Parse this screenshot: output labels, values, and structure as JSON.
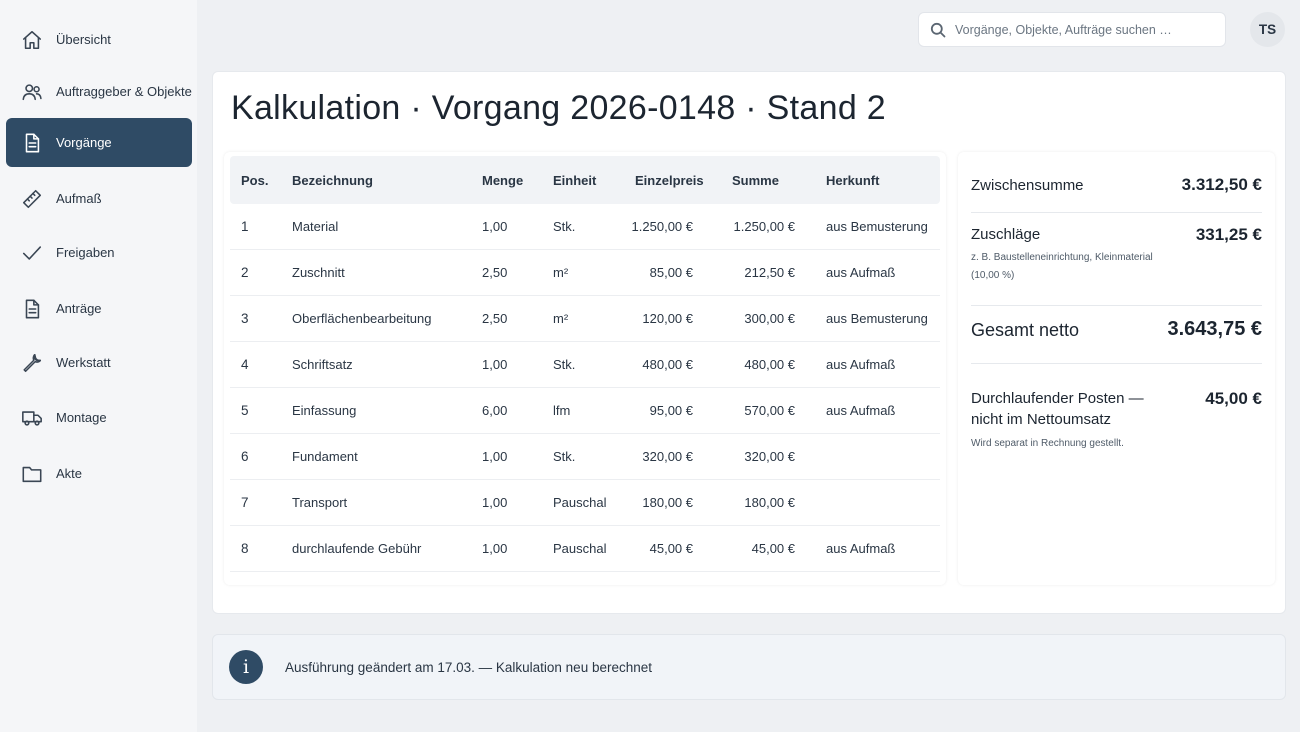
{
  "sidebar": {
    "items": [
      {
        "label": "Übersicht",
        "icon": "home-icon",
        "active": false
      },
      {
        "label": "Auftraggeber & Objekte",
        "icon": "users-icon",
        "active": false
      },
      {
        "label": "Vorgänge",
        "icon": "document-icon",
        "active": true
      },
      {
        "label": "Aufmaß",
        "icon": "ruler-icon",
        "active": false
      },
      {
        "label": "Freigaben",
        "icon": "checkmark-icon",
        "active": false
      },
      {
        "label": "Anträge",
        "icon": "document-icon",
        "active": false
      },
      {
        "label": "Werkstatt",
        "icon": "wrench-icon",
        "active": false
      },
      {
        "label": "Montage",
        "icon": "truck-icon",
        "active": false
      },
      {
        "label": "Akte",
        "icon": "folder-icon",
        "active": false
      }
    ]
  },
  "topbar": {
    "search_placeholder": "Vorgänge, Objekte, Aufträge suchen …",
    "avatar_initials": "TS"
  },
  "page": {
    "title": "Kalkulation · Vorgang 2026-0148 · Stand 2"
  },
  "table": {
    "headers": {
      "pos": "Pos.",
      "bezeichnung": "Bezeichnung",
      "menge": "Menge",
      "einheit": "Einheit",
      "einzelpreis": "Einzelpreis",
      "summe": "Summe",
      "herkunft": "Herkunft"
    },
    "rows": [
      {
        "pos": "1",
        "bezeichnung": "Material",
        "menge": "1,00",
        "einheit": "Stk.",
        "einzelpreis": "1.250,00 €",
        "summe": "1.250,00 €",
        "herkunft": "aus Bemusterung"
      },
      {
        "pos": "2",
        "bezeichnung": "Zuschnitt",
        "menge": "2,50",
        "einheit": "m²",
        "einzelpreis": "85,00 €",
        "summe": "212,50 €",
        "herkunft": "aus Aufmaß"
      },
      {
        "pos": "3",
        "bezeichnung": "Oberflächenbearbeitung",
        "menge": "2,50",
        "einheit": "m²",
        "einzelpreis": "120,00 €",
        "summe": "300,00 €",
        "herkunft": "aus Bemusterung"
      },
      {
        "pos": "4",
        "bezeichnung": "Schriftsatz",
        "menge": "1,00",
        "einheit": "Stk.",
        "einzelpreis": "480,00 €",
        "summe": "480,00 €",
        "herkunft": "aus Aufmaß"
      },
      {
        "pos": "5",
        "bezeichnung": "Einfassung",
        "menge": "6,00",
        "einheit": "lfm",
        "einzelpreis": "95,00 €",
        "summe": "570,00 €",
        "herkunft": "aus Aufmaß"
      },
      {
        "pos": "6",
        "bezeichnung": "Fundament",
        "menge": "1,00",
        "einheit": "Stk.",
        "einzelpreis": "320,00 €",
        "summe": "320,00 €",
        "herkunft": ""
      },
      {
        "pos": "7",
        "bezeichnung": "Transport",
        "menge": "1,00",
        "einheit": "Pauschal",
        "einzelpreis": "180,00 €",
        "summe": "180,00 €",
        "herkunft": ""
      },
      {
        "pos": "8",
        "bezeichnung": "durchlaufende Gebühr",
        "menge": "1,00",
        "einheit": "Pauschal",
        "einzelpreis": "45,00 €",
        "summe": "45,00 €",
        "herkunft": "aus Aufmaß"
      }
    ]
  },
  "summary": {
    "zwischensumme_label": "Zwischensumme",
    "zwischensumme_value": "3.312,50 €",
    "zuschlaege_label": "Zuschläge",
    "zuschlaege_value": "331,25 €",
    "zuschlaege_note_1": "z. B. Baustelleneinrichtung, Kleinmaterial",
    "zuschlaege_note_2": "(10,00 %)",
    "gesamt_label": "Gesamt netto",
    "gesamt_value": "3.643,75 €",
    "durchlaufend_label_1": "Durchlaufender Posten —",
    "durchlaufend_label_2": "nicht im Nettoumsatz",
    "durchlaufend_value": "45,00 €",
    "durchlaufend_note": "Wird separat in Rechnung gestellt."
  },
  "info": {
    "text": "Ausführung geändert am 17.03. — Kalkulation neu berechnet"
  },
  "colors": {
    "accent": "#2f4b65",
    "background": "#eef0f3"
  }
}
